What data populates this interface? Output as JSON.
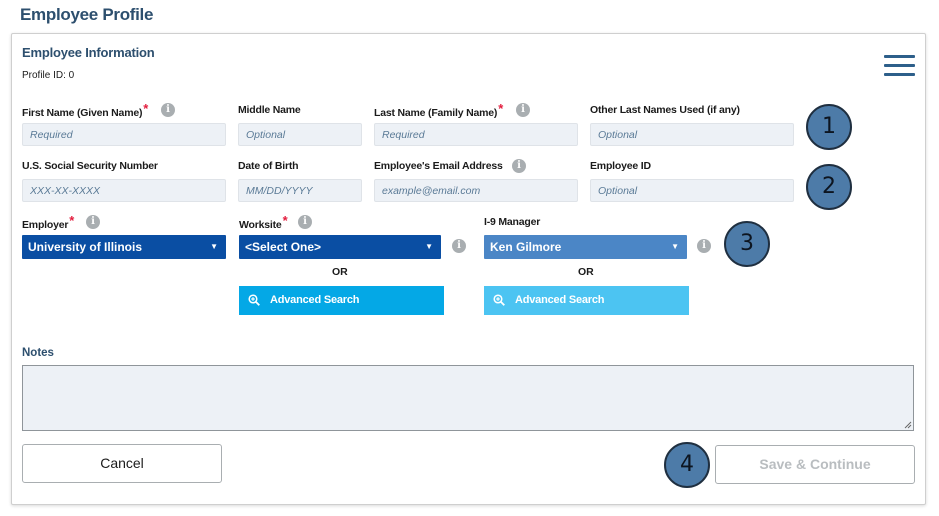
{
  "page": {
    "title": "Employee Profile"
  },
  "section": {
    "title": "Employee Information",
    "profile_id": "Profile ID: 0"
  },
  "row1": {
    "first_name": {
      "label": "First Name (Given Name)",
      "placeholder": "Required",
      "required": true
    },
    "middle_name": {
      "label": "Middle Name",
      "placeholder": "Optional"
    },
    "last_name": {
      "label": "Last Name (Family Name)",
      "placeholder": "Required",
      "required": true
    },
    "other_last_names": {
      "label": "Other Last Names Used (if any)",
      "placeholder": "Optional"
    }
  },
  "row2": {
    "ssn": {
      "label": "U.S. Social Security Number",
      "placeholder": "XXX-XX-XXXX"
    },
    "dob": {
      "label": "Date of Birth",
      "placeholder": "MM/DD/YYYY"
    },
    "email": {
      "label": "Employee's Email Address",
      "placeholder": "example@email.com"
    },
    "employee_id": {
      "label": "Employee ID",
      "placeholder": "Optional"
    }
  },
  "row3": {
    "employer": {
      "label": "Employer",
      "value": "University of Illinois",
      "required": true
    },
    "worksite": {
      "label": "Worksite",
      "value": "<Select One>",
      "required": true
    },
    "i9_manager": {
      "label": "I-9 Manager",
      "value": "Ken Gilmore"
    },
    "or_text": "OR",
    "advanced_search": "Advanced Search"
  },
  "notes": {
    "label": "Notes"
  },
  "buttons": {
    "cancel": "Cancel",
    "save": "Save & Continue"
  },
  "badges": [
    "1",
    "2",
    "3",
    "4"
  ],
  "icons": {
    "menu": "hamburger-menu-icon",
    "info": "info-icon",
    "caret": "caret-down-icon",
    "search": "magnifier-plus-icon"
  },
  "colors": {
    "title": "#2d4f6e",
    "select": "#0a4ea3",
    "select_light": "#4b86c6",
    "advanced_search": "#04a8e6",
    "advanced_search_light": "#4cc4f2",
    "required": "#e31c3d",
    "badge": "#4d7ba8"
  }
}
